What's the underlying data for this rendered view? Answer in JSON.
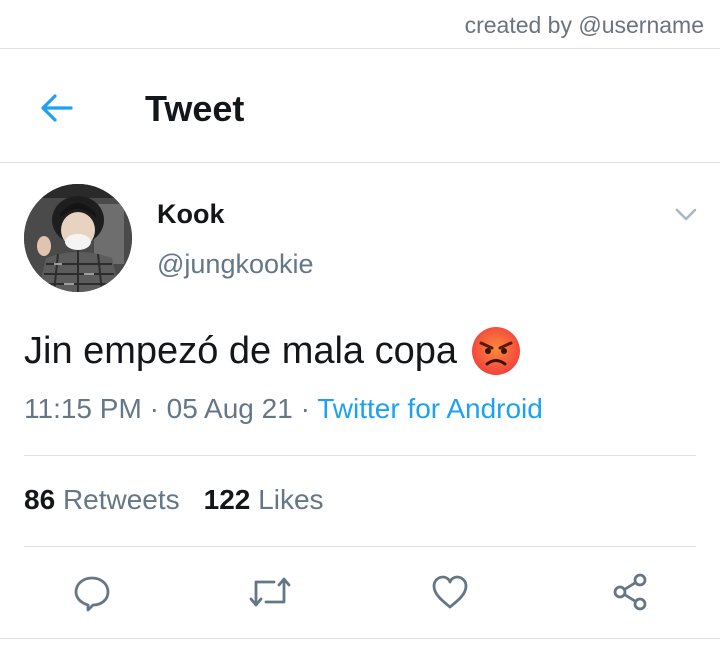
{
  "watermark": "created by @username",
  "header": {
    "title": "Tweet",
    "back_icon": "arrow-left-icon"
  },
  "tweet": {
    "author_name": "Kook",
    "author_handle": "@jungkookie",
    "text": "Jin empezó de mala copa",
    "emoji": "angry-face",
    "time": "11:15 PM",
    "separator": "·",
    "date": "05 Aug 21",
    "source": "Twitter for Android"
  },
  "stats": {
    "retweets_count": "86",
    "retweets_label": "Retweets",
    "likes_count": "122",
    "likes_label": "Likes"
  },
  "actions": [
    "reply-icon",
    "retweet-icon",
    "like-icon",
    "share-icon"
  ],
  "colors": {
    "accent": "#1da1f2",
    "secondary_text": "#657786",
    "primary_text": "#14171a",
    "divider": "#dfe3e6"
  }
}
